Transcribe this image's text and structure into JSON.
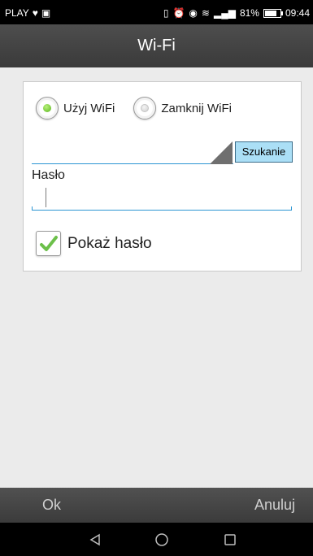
{
  "status_bar": {
    "carrier": "PLAY",
    "battery_percent": "81%",
    "time": "09:44"
  },
  "title": "Wi-Fi",
  "wifi_mode": {
    "options": [
      {
        "label": "Użyj WiFi",
        "selected": true
      },
      {
        "label": "Zamknij WiFi",
        "selected": false
      }
    ]
  },
  "network": {
    "ssid_value": "",
    "search_button": "Szukanie"
  },
  "password": {
    "label": "Hasło",
    "value": ""
  },
  "show_password": {
    "label": "Pokaż hasło",
    "checked": true
  },
  "actions": {
    "ok": "Ok",
    "cancel": "Anuluj"
  },
  "colors": {
    "accent": "#2b95d3",
    "check_green": "#6cc04a",
    "search_button_bg": "#abdff6"
  }
}
